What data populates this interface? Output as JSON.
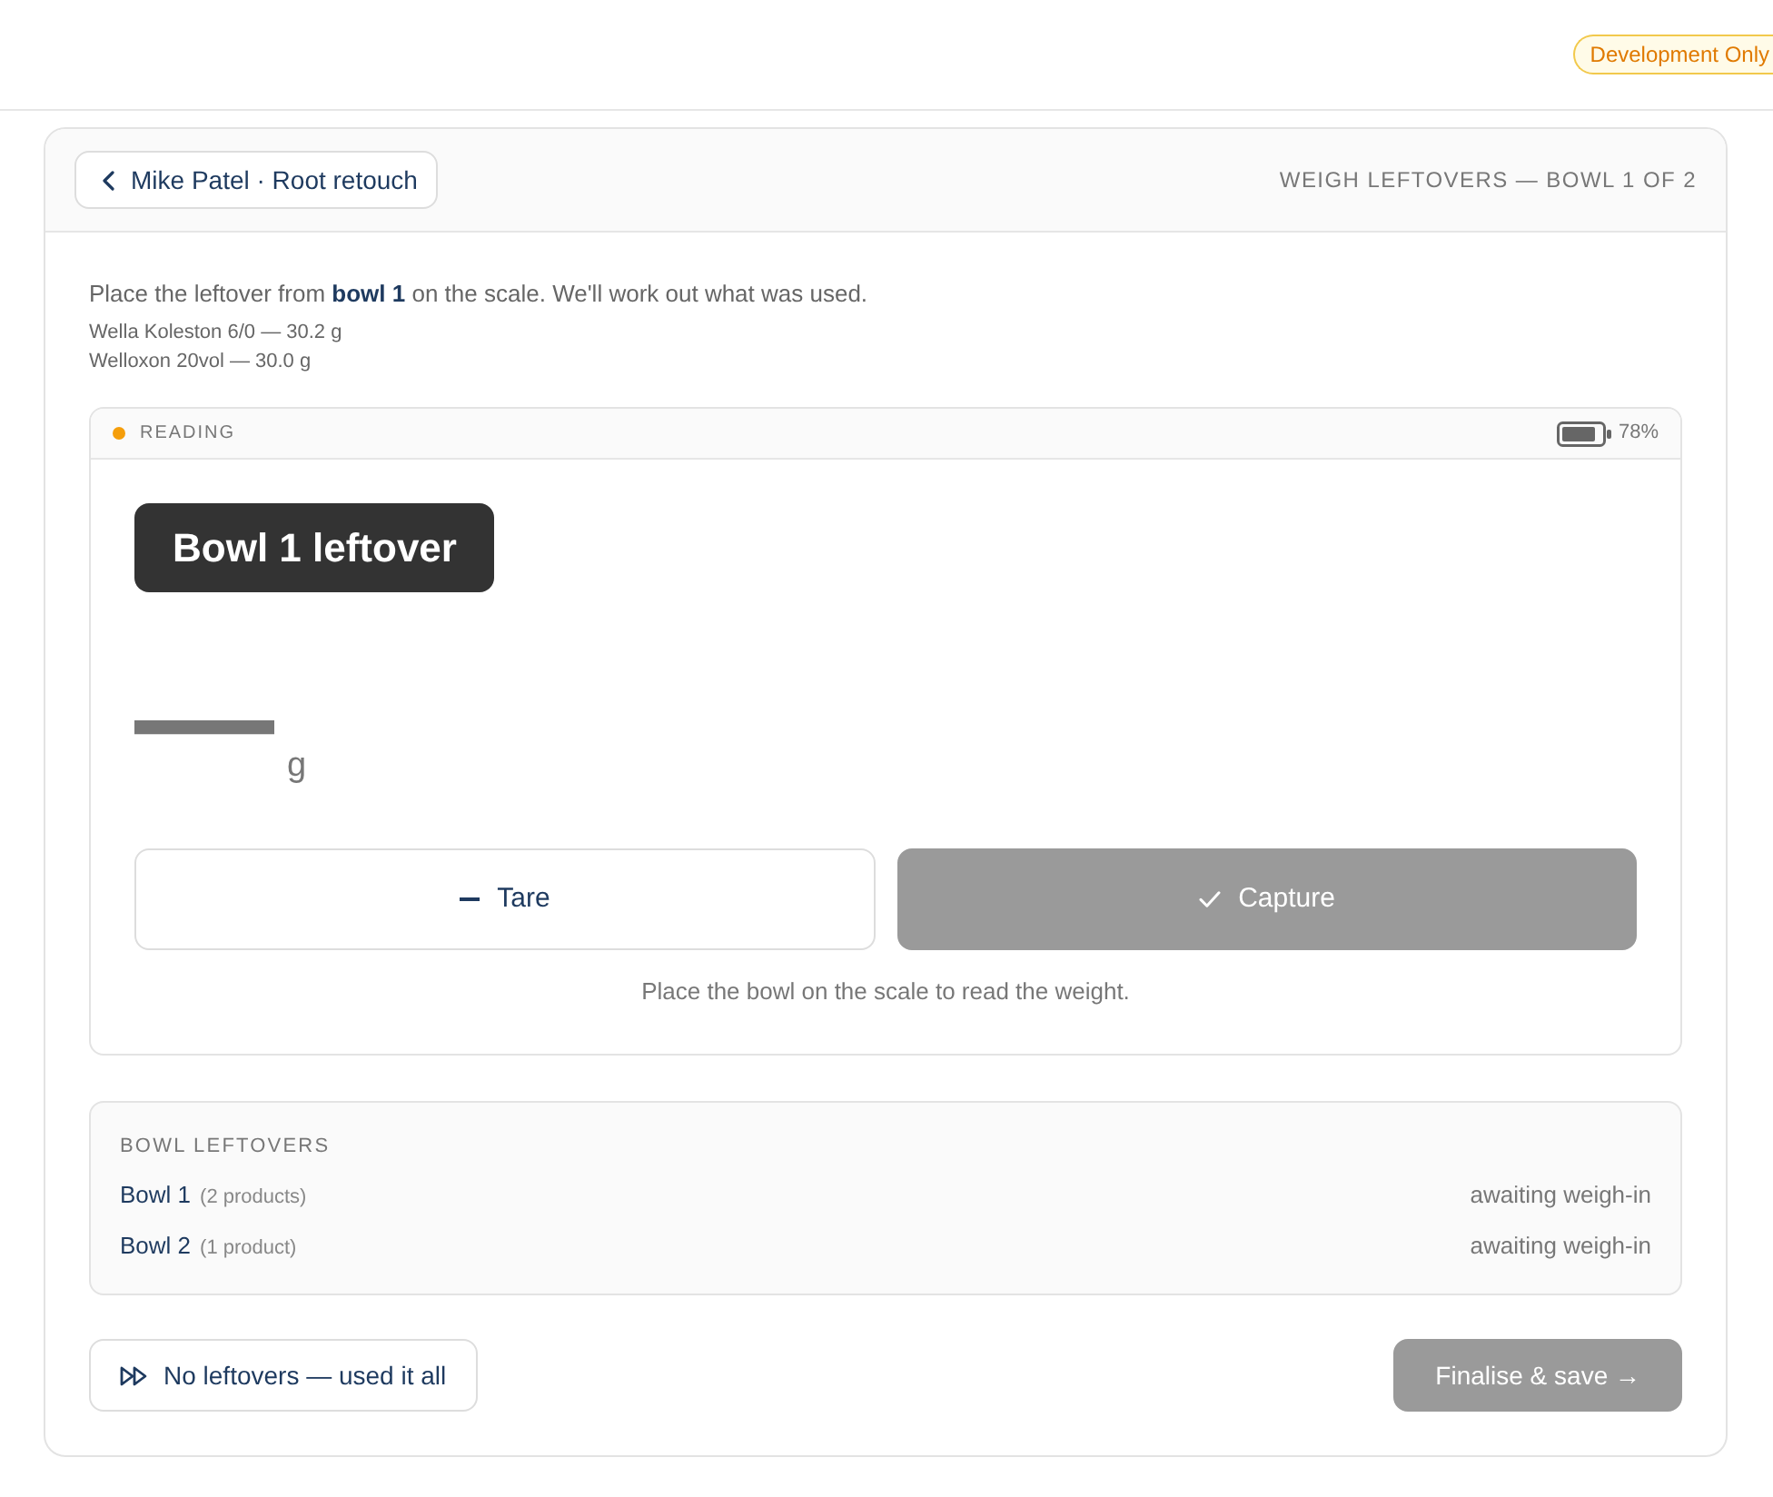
{
  "header": {
    "badge": "Development Only"
  },
  "card": {
    "back_button": {
      "label": "Mike Patel · Root retouch"
    },
    "step": "WEIGH LEFTOVERS — BOWL 1 OF 2",
    "instruction": "Place the leftover from **bowl 1** on the scale. We'll work out what was used.",
    "products": [
      "Wella Koleston 6/0 — 30.2 g",
      "Welloxon 20vol — 30.0 g"
    ],
    "scale": {
      "status": {
        "kind": "reading",
        "label": "READING"
      },
      "battery": "78%",
      "bowl_label": "Bowl 1 leftover",
      "weight": {
        "value": "—",
        "unit": "g"
      },
      "buttons": [
        {
          "kind": "tare",
          "label": "Tare",
          "disabled": false
        },
        {
          "kind": "capture",
          "label": "Capture",
          "disabled": true
        }
      ],
      "hint": "Place the bowl on the scale to read the weight."
    },
    "leftovers": {
      "title": "BOWL LEFTOVERS",
      "rows": [
        {
          "name": "Bowl 1",
          "count": "(2 products)",
          "status": "awaiting weigh-in"
        },
        {
          "name": "Bowl 2",
          "count": "(1 product)",
          "status": "awaiting weigh-in"
        }
      ]
    },
    "footer": {
      "skip_button": {
        "label": "No leftovers — used it all"
      },
      "finalise_button": {
        "label": "Finalise & save →",
        "disabled": true
      }
    }
  }
}
